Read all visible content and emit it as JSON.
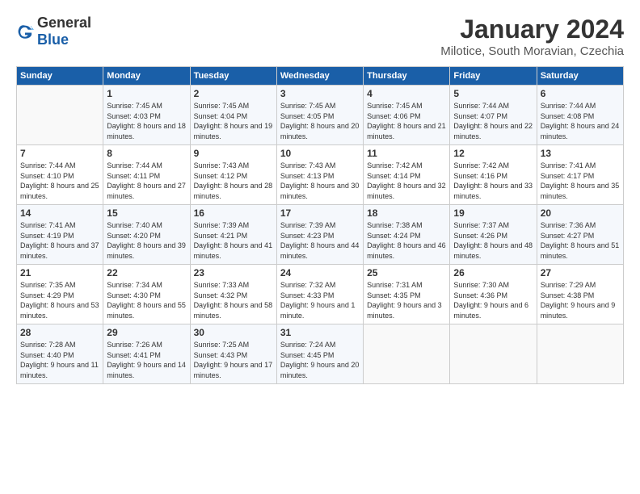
{
  "logo": {
    "general": "General",
    "blue": "Blue"
  },
  "header": {
    "month": "January 2024",
    "location": "Milotice, South Moravian, Czechia"
  },
  "weekdays": [
    "Sunday",
    "Monday",
    "Tuesday",
    "Wednesday",
    "Thursday",
    "Friday",
    "Saturday"
  ],
  "weeks": [
    [
      {
        "day": "",
        "sunrise": "",
        "sunset": "",
        "daylight": ""
      },
      {
        "day": "1",
        "sunrise": "Sunrise: 7:45 AM",
        "sunset": "Sunset: 4:03 PM",
        "daylight": "Daylight: 8 hours and 18 minutes."
      },
      {
        "day": "2",
        "sunrise": "Sunrise: 7:45 AM",
        "sunset": "Sunset: 4:04 PM",
        "daylight": "Daylight: 8 hours and 19 minutes."
      },
      {
        "day": "3",
        "sunrise": "Sunrise: 7:45 AM",
        "sunset": "Sunset: 4:05 PM",
        "daylight": "Daylight: 8 hours and 20 minutes."
      },
      {
        "day": "4",
        "sunrise": "Sunrise: 7:45 AM",
        "sunset": "Sunset: 4:06 PM",
        "daylight": "Daylight: 8 hours and 21 minutes."
      },
      {
        "day": "5",
        "sunrise": "Sunrise: 7:44 AM",
        "sunset": "Sunset: 4:07 PM",
        "daylight": "Daylight: 8 hours and 22 minutes."
      },
      {
        "day": "6",
        "sunrise": "Sunrise: 7:44 AM",
        "sunset": "Sunset: 4:08 PM",
        "daylight": "Daylight: 8 hours and 24 minutes."
      }
    ],
    [
      {
        "day": "7",
        "sunrise": "Sunrise: 7:44 AM",
        "sunset": "Sunset: 4:10 PM",
        "daylight": "Daylight: 8 hours and 25 minutes."
      },
      {
        "day": "8",
        "sunrise": "Sunrise: 7:44 AM",
        "sunset": "Sunset: 4:11 PM",
        "daylight": "Daylight: 8 hours and 27 minutes."
      },
      {
        "day": "9",
        "sunrise": "Sunrise: 7:43 AM",
        "sunset": "Sunset: 4:12 PM",
        "daylight": "Daylight: 8 hours and 28 minutes."
      },
      {
        "day": "10",
        "sunrise": "Sunrise: 7:43 AM",
        "sunset": "Sunset: 4:13 PM",
        "daylight": "Daylight: 8 hours and 30 minutes."
      },
      {
        "day": "11",
        "sunrise": "Sunrise: 7:42 AM",
        "sunset": "Sunset: 4:14 PM",
        "daylight": "Daylight: 8 hours and 32 minutes."
      },
      {
        "day": "12",
        "sunrise": "Sunrise: 7:42 AM",
        "sunset": "Sunset: 4:16 PM",
        "daylight": "Daylight: 8 hours and 33 minutes."
      },
      {
        "day": "13",
        "sunrise": "Sunrise: 7:41 AM",
        "sunset": "Sunset: 4:17 PM",
        "daylight": "Daylight: 8 hours and 35 minutes."
      }
    ],
    [
      {
        "day": "14",
        "sunrise": "Sunrise: 7:41 AM",
        "sunset": "Sunset: 4:19 PM",
        "daylight": "Daylight: 8 hours and 37 minutes."
      },
      {
        "day": "15",
        "sunrise": "Sunrise: 7:40 AM",
        "sunset": "Sunset: 4:20 PM",
        "daylight": "Daylight: 8 hours and 39 minutes."
      },
      {
        "day": "16",
        "sunrise": "Sunrise: 7:39 AM",
        "sunset": "Sunset: 4:21 PM",
        "daylight": "Daylight: 8 hours and 41 minutes."
      },
      {
        "day": "17",
        "sunrise": "Sunrise: 7:39 AM",
        "sunset": "Sunset: 4:23 PM",
        "daylight": "Daylight: 8 hours and 44 minutes."
      },
      {
        "day": "18",
        "sunrise": "Sunrise: 7:38 AM",
        "sunset": "Sunset: 4:24 PM",
        "daylight": "Daylight: 8 hours and 46 minutes."
      },
      {
        "day": "19",
        "sunrise": "Sunrise: 7:37 AM",
        "sunset": "Sunset: 4:26 PM",
        "daylight": "Daylight: 8 hours and 48 minutes."
      },
      {
        "day": "20",
        "sunrise": "Sunrise: 7:36 AM",
        "sunset": "Sunset: 4:27 PM",
        "daylight": "Daylight: 8 hours and 51 minutes."
      }
    ],
    [
      {
        "day": "21",
        "sunrise": "Sunrise: 7:35 AM",
        "sunset": "Sunset: 4:29 PM",
        "daylight": "Daylight: 8 hours and 53 minutes."
      },
      {
        "day": "22",
        "sunrise": "Sunrise: 7:34 AM",
        "sunset": "Sunset: 4:30 PM",
        "daylight": "Daylight: 8 hours and 55 minutes."
      },
      {
        "day": "23",
        "sunrise": "Sunrise: 7:33 AM",
        "sunset": "Sunset: 4:32 PM",
        "daylight": "Daylight: 8 hours and 58 minutes."
      },
      {
        "day": "24",
        "sunrise": "Sunrise: 7:32 AM",
        "sunset": "Sunset: 4:33 PM",
        "daylight": "Daylight: 9 hours and 1 minute."
      },
      {
        "day": "25",
        "sunrise": "Sunrise: 7:31 AM",
        "sunset": "Sunset: 4:35 PM",
        "daylight": "Daylight: 9 hours and 3 minutes."
      },
      {
        "day": "26",
        "sunrise": "Sunrise: 7:30 AM",
        "sunset": "Sunset: 4:36 PM",
        "daylight": "Daylight: 9 hours and 6 minutes."
      },
      {
        "day": "27",
        "sunrise": "Sunrise: 7:29 AM",
        "sunset": "Sunset: 4:38 PM",
        "daylight": "Daylight: 9 hours and 9 minutes."
      }
    ],
    [
      {
        "day": "28",
        "sunrise": "Sunrise: 7:28 AM",
        "sunset": "Sunset: 4:40 PM",
        "daylight": "Daylight: 9 hours and 11 minutes."
      },
      {
        "day": "29",
        "sunrise": "Sunrise: 7:26 AM",
        "sunset": "Sunset: 4:41 PM",
        "daylight": "Daylight: 9 hours and 14 minutes."
      },
      {
        "day": "30",
        "sunrise": "Sunrise: 7:25 AM",
        "sunset": "Sunset: 4:43 PM",
        "daylight": "Daylight: 9 hours and 17 minutes."
      },
      {
        "day": "31",
        "sunrise": "Sunrise: 7:24 AM",
        "sunset": "Sunset: 4:45 PM",
        "daylight": "Daylight: 9 hours and 20 minutes."
      },
      {
        "day": "",
        "sunrise": "",
        "sunset": "",
        "daylight": ""
      },
      {
        "day": "",
        "sunrise": "",
        "sunset": "",
        "daylight": ""
      },
      {
        "day": "",
        "sunrise": "",
        "sunset": "",
        "daylight": ""
      }
    ]
  ]
}
